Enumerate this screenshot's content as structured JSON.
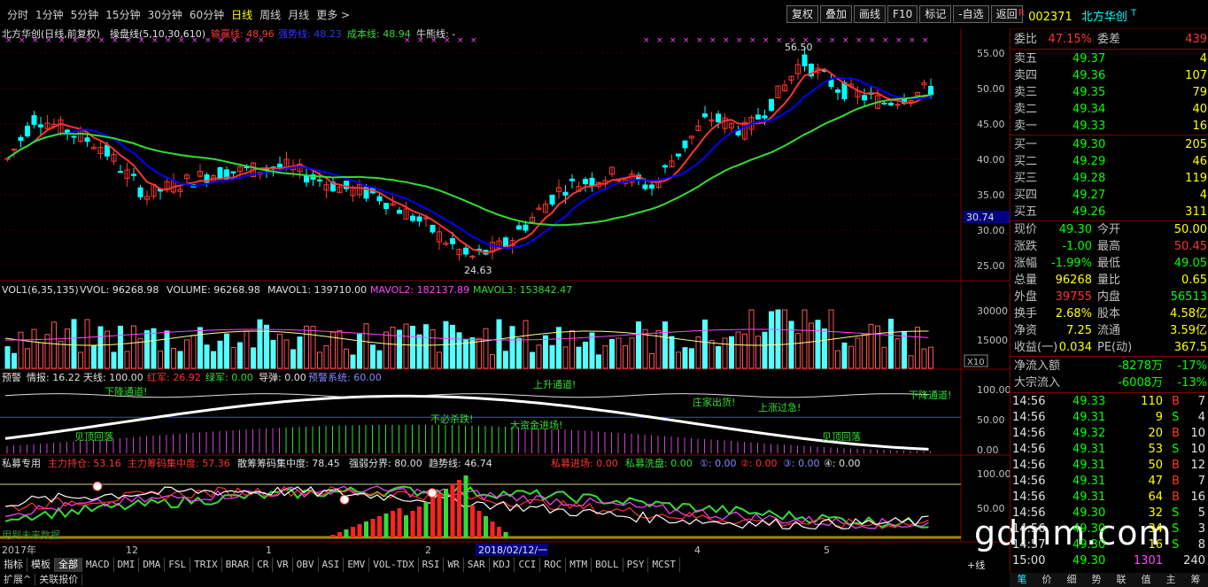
{
  "periods": [
    "分时",
    "1分钟",
    "5分钟",
    "15分钟",
    "30分钟",
    "60分钟",
    "日线",
    "周线",
    "月线",
    "更多 >"
  ],
  "active_period": "日线",
  "tools": [
    "复权",
    "叠加",
    "画线",
    "F10",
    "标记",
    "-自选",
    "返回"
  ],
  "stock": {
    "r": "R",
    "code": "002371",
    "name": "北方华创",
    "tag": "T"
  },
  "main_header": {
    "name": "北方华创(日线,前复权)",
    "ind": "操盘线(5,10,30,610)",
    "l1": "输赢线: 48.96",
    "l2": "强势线: 48.23",
    "l3": "成本线: 48.94",
    "l4": "牛熊线: -"
  },
  "price_axis": [
    "55.00",
    "50.00",
    "45.00",
    "40.00",
    "35.00",
    "30.00",
    "25.00"
  ],
  "price_current": "30.74",
  "high_label": "56.50",
  "low_label": "24.63",
  "vol_header": {
    "a": "VOL1(6,35,135)",
    "b": "VVOL: 96268.98",
    "c": "VOLUME: 96268.98",
    "d": "MAVOL1: 139710.00",
    "e": "MAVOL2: 182137.89",
    "f": "MAVOL3: 153842.47"
  },
  "vol_axis": [
    "30000",
    "15000"
  ],
  "vol_unit": "X10",
  "warn_header": {
    "a": "预警",
    "b": "情报: 16.22",
    "c": "天线: 100.00",
    "d": "红军: 26.92",
    "e": "绿军: 0.00",
    "f": "导弹: 0.00",
    "g": "预警系统: 60.00"
  },
  "warn_axis": [
    "100.00",
    "50.00",
    "0.00"
  ],
  "warn_labels": [
    "下降通道!",
    "见顶回落",
    "不必杀跌!",
    "大资金进场!",
    "上升通道!",
    "庄家出货!",
    "上涨过急!",
    "见顶回落",
    "下降通道!"
  ],
  "pm_header": {
    "a": "私募专用",
    "b": "主力持仓: 53.16",
    "c": "主力筹码集中度: 57.36",
    "d": "散筹筹码集中度: 78.45",
    "e": "强弱分界: 80.00",
    "f": "趋势线: 46.74",
    "g": "私募进场: 0.00",
    "h": "私募洗盘: 0.00",
    "i": "①: 0.00",
    "j": "②: 0.00",
    "k": "③: 0.00",
    "l": "④: 0.00"
  },
  "pm_axis": [
    "100.00",
    "50.00"
  ],
  "pm_note": "用到未来数据",
  "date_axis": {
    "a": "2017年",
    "b": "12",
    "c": "1",
    "d": "2",
    "e": "2018/02/12/一",
    "f": "4",
    "g": "5"
  },
  "bottom_tabs": [
    "指标",
    "模板",
    "全部",
    "MACD",
    "DMI",
    "DMA",
    "FSL",
    "TRIX",
    "BRAR",
    "CR",
    "VR",
    "OBV",
    "ASI",
    "EMV",
    "VOL-TDX",
    "RSI",
    "WR",
    "SAR",
    "KDJ",
    "CCI",
    "ROC",
    "MTM",
    "BOLL",
    "PSY",
    "MCST"
  ],
  "bottom_right": "+线",
  "status_tabs": [
    "扩展^",
    "关联报价"
  ],
  "right_tabs": [
    "笔",
    "价",
    "细",
    "势",
    "联",
    "值",
    "主",
    "筹"
  ],
  "quote": {
    "wb_label": "委比",
    "wb": "47.15%",
    "wc_label": "委差",
    "wc": "439",
    "sell": [
      {
        "l": "卖五",
        "p": "49.37",
        "v": "4"
      },
      {
        "l": "卖四",
        "p": "49.36",
        "v": "107"
      },
      {
        "l": "卖三",
        "p": "49.35",
        "v": "79"
      },
      {
        "l": "卖二",
        "p": "49.34",
        "v": "40"
      },
      {
        "l": "卖一",
        "p": "49.33",
        "v": "16"
      }
    ],
    "buy": [
      {
        "l": "买一",
        "p": "49.30",
        "v": "205"
      },
      {
        "l": "买二",
        "p": "49.29",
        "v": "46"
      },
      {
        "l": "买三",
        "p": "49.28",
        "v": "119"
      },
      {
        "l": "买四",
        "p": "49.27",
        "v": "4"
      },
      {
        "l": "买五",
        "p": "49.26",
        "v": "311"
      }
    ],
    "info": [
      {
        "l": "现价",
        "v": "49.30",
        "l2": "今开",
        "v2": "50.00"
      },
      {
        "l": "涨跌",
        "v": "-1.00",
        "l2": "最高",
        "v2": "50.45"
      },
      {
        "l": "涨幅",
        "v": "-1.99%",
        "l2": "最低",
        "v2": "49.05"
      },
      {
        "l": "总量",
        "v": "96268",
        "l2": "量比",
        "v2": "0.65"
      },
      {
        "l": "外盘",
        "v": "39755",
        "l2": "内盘",
        "v2": "56513"
      },
      {
        "l": "换手",
        "v": "2.68%",
        "l2": "股本",
        "v2": "4.58亿"
      },
      {
        "l": "净资",
        "v": "7.25",
        "l2": "流通",
        "v2": "3.59亿"
      },
      {
        "l": "收益(一)",
        "v": "0.034",
        "l2": "PE(动)",
        "v2": "367.5"
      }
    ],
    "flow": [
      {
        "l": "净流入额",
        "v": "-8278万",
        "p": "-17%"
      },
      {
        "l": "大宗流入",
        "v": "-6008万",
        "p": "-13%"
      }
    ],
    "ticks": [
      {
        "t": "14:56",
        "p": "49.33",
        "q": "110",
        "s": "B",
        "n": "7"
      },
      {
        "t": "14:56",
        "p": "49.31",
        "q": "9",
        "s": "S",
        "n": "4"
      },
      {
        "t": "14:56",
        "p": "49.32",
        "q": "20",
        "s": "B",
        "n": "10"
      },
      {
        "t": "14:56",
        "p": "49.31",
        "q": "53",
        "s": "S",
        "n": "10"
      },
      {
        "t": "14:56",
        "p": "49.31",
        "q": "50",
        "s": "B",
        "n": "12"
      },
      {
        "t": "14:56",
        "p": "49.31",
        "q": "47",
        "s": "B",
        "n": "7"
      },
      {
        "t": "14:56",
        "p": "49.31",
        "q": "64",
        "s": "B",
        "n": "16"
      },
      {
        "t": "14:56",
        "p": "49.30",
        "q": "32",
        "s": "S",
        "n": "5"
      },
      {
        "t": "14:56",
        "p": "49.30",
        "q": "34",
        "s": "S",
        "n": "3"
      },
      {
        "t": "14:57",
        "p": "49.30",
        "q": "16",
        "s": "S",
        "n": "8"
      },
      {
        "t": "15:00",
        "p": "49.30",
        "q": "1301",
        "s": "",
        "n": "240"
      }
    ]
  },
  "watermark": "gdmm.com",
  "colors": {
    "up": "#ff3333",
    "down": "#00ffff",
    "ma1": "#ff3333",
    "ma2": "#0000ff",
    "ma3": "#33dd33",
    "grid": "#800000"
  }
}
